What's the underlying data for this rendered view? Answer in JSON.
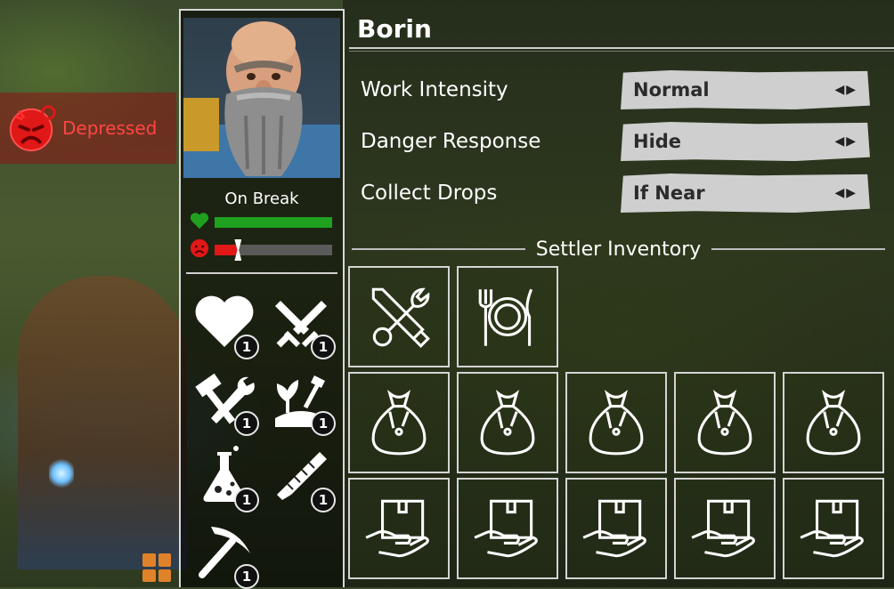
{
  "settler": {
    "name": "Borin",
    "status": "On Break",
    "mood": "Depressed",
    "health_fraction": 1.0,
    "mood_fraction": 0.2
  },
  "skills": [
    {
      "name": "heart-icon",
      "level": "1"
    },
    {
      "name": "swords-icon",
      "level": "1"
    },
    {
      "name": "hammer-wrench-icon",
      "level": "1"
    },
    {
      "name": "farming-icon",
      "level": "1"
    },
    {
      "name": "flask-icon",
      "level": "1"
    },
    {
      "name": "saw-icon",
      "level": "1"
    },
    {
      "name": "pickaxe-icon",
      "level": "1"
    }
  ],
  "options": [
    {
      "label": "Work Intensity",
      "value": "Normal"
    },
    {
      "label": "Danger Response",
      "value": "Hide"
    },
    {
      "label": "Collect Drops",
      "value": "If Near"
    }
  ],
  "inventory": {
    "title": "Settler Inventory",
    "slots": [
      "tools-icon",
      "food-icon",
      "sack-icon",
      "sack-icon",
      "sack-icon",
      "sack-icon",
      "sack-icon",
      "hand-box-icon",
      "hand-box-icon",
      "hand-box-icon",
      "hand-box-icon",
      "hand-box-icon"
    ]
  },
  "colors": {
    "health": "#1fa11f",
    "mood": "#e01818",
    "mood_label": "#ff4545",
    "menu_icon": "#e0822a"
  }
}
